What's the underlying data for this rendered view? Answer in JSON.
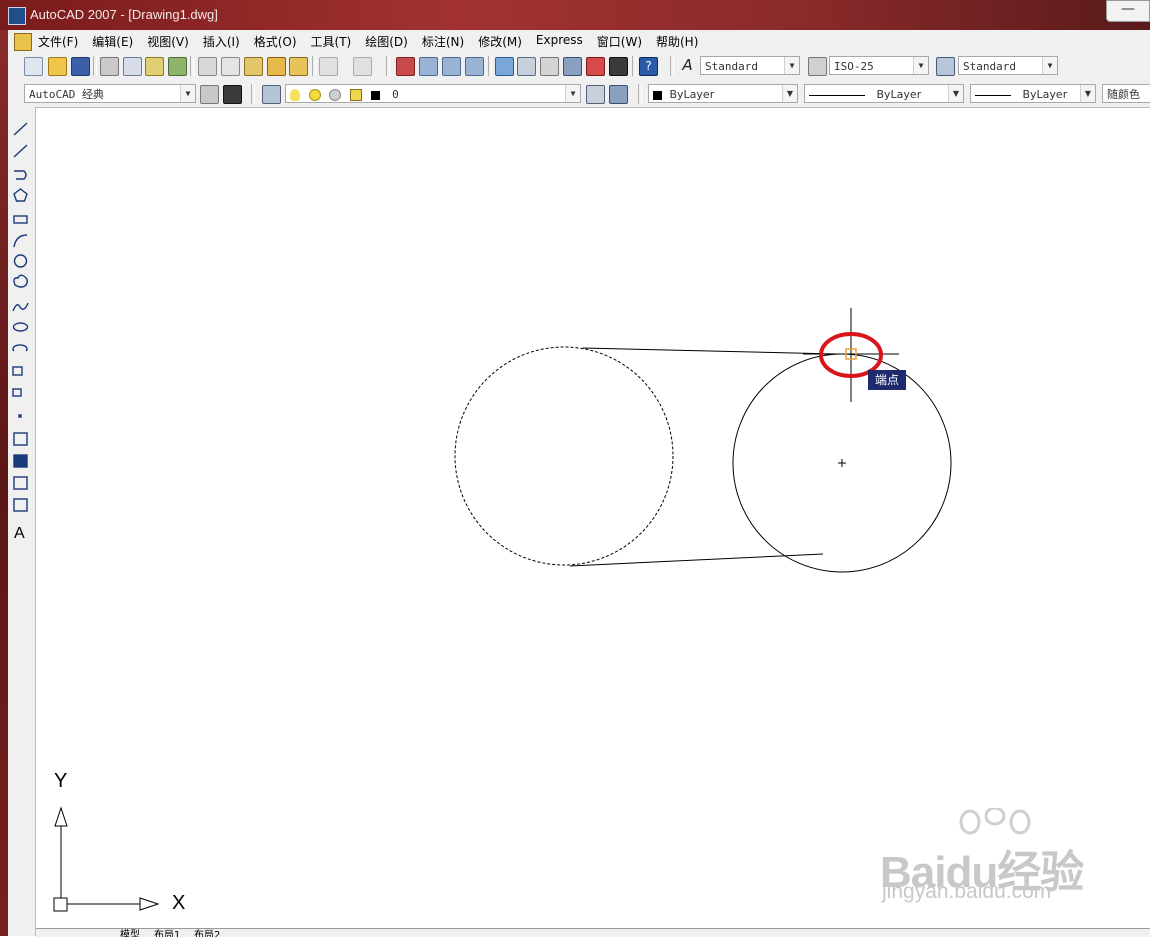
{
  "window": {
    "title": "AutoCAD 2007 - [Drawing1.dwg]",
    "minimize_glyph": "—"
  },
  "menu": {
    "items": [
      "文件(F)",
      "编辑(E)",
      "视图(V)",
      "插入(I)",
      "格式(O)",
      "工具(T)",
      "绘图(D)",
      "标注(N)",
      "修改(M)",
      "Express",
      "窗口(W)",
      "帮助(H)"
    ]
  },
  "toolbar1": {
    "text_style": "Standard",
    "dim_style": "ISO-25",
    "table_style": "Standard"
  },
  "toolbar2": {
    "workspace": "AutoCAD 经典",
    "layer": "0",
    "color": "ByLayer",
    "linetype": "ByLayer",
    "lineweight": "ByLayer",
    "plot_style": "随颜色"
  },
  "canvas": {
    "snap_tooltip": "端点",
    "ucs_x": "X",
    "ucs_y": "Y"
  },
  "status": {
    "tabs": [
      "模型",
      "布局1",
      "布局2"
    ]
  },
  "watermark": {
    "brand": "Baidu经验",
    "url": "jingyan.baidu.com"
  },
  "colors": {
    "highlight_circle": "#d9141b",
    "snap_marker": "#e8a23a",
    "tooltip_bg": "#1e2a6e"
  }
}
